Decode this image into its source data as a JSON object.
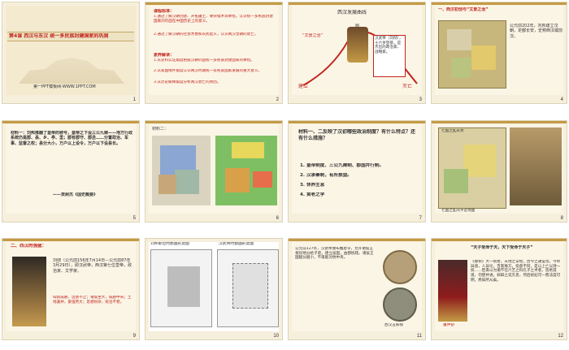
{
  "slides": [
    {
      "n": "1",
      "title": "第4课  西汉与东汉  统一多民族封建国家的巩固",
      "site": "第一PPT模板网-WWW.1PPT.COM"
    },
    {
      "n": "2",
      "heading": "课程标准：",
      "lines": [
        "1.通过了解汉朝创建、开拓疆土、尊崇儒术等举措，认识统一多民族封建国家的巩固在中国历史上的意义。",
        "2.通过了解汉朝的社会矛盾和农民起义，认识两汉皇朝的衰亡。"
      ],
      "heading2": "素养解读：",
      "lines2": [
        "1.从史料实证角度把握汉朝巩固统一多民族封建国家的举措。",
        "2.从家国情怀角度认识两汉时期统一多民族国家发展的重大意义。",
        "3.从历史解释角度分析两汉衰亡的原因。"
      ]
    },
    {
      "n": "3",
      "title": "西汉发展曲线",
      "label_tu": "图",
      "left_label": "“文景之治”",
      "apex_label": "汉武帝（刘彻），十六岁登基，是杰出的政治家、战略家。",
      "start": "建立",
      "end": "灭亡"
    },
    {
      "n": "4",
      "heading": "一、西汉初创与“文景之治”",
      "text": "公元前202年，刘邦建立汉朝，定都长安，史称西汉或前汉。"
    },
    {
      "n": "5",
      "quote": "材料一：刘邦推翻了皇帝的称号，皇帝之下设三公九卿——地方行政系统仍是郡、县、乡、亭、里；郡有郡守、郡丞……分置政治、军事、监督之权；县分大小，万户以上设令，万户以下设县长。",
      "source": "——贾树杰《国史概要》"
    },
    {
      "n": "6",
      "label": "材料二："
    },
    {
      "n": "7",
      "question": "材料一、二反映了汉初哪些政治制度？有什么特点？还有什么措施？",
      "points": [
        "1. 皇帝制度、三公九卿制、郡国并行制。",
        "2. 汉承秦制，有所损益。",
        "3. 休养生息",
        "4. 黄老之学"
      ]
    },
    {
      "n": "8",
      "map_title": "七国之乱形势",
      "caption": "七国之乱的平定地图"
    },
    {
      "n": "9",
      "heading": "二、西汉的强盛：",
      "bio": "刘彻（公元前156年7月14日－公元前87年3月29日），即汉武帝，西汉第七位皇帝，政治家、文学家。",
      "extra": "匈奴威胁，边患不止；诸侯坐大，威胁中央；土地兼并，豪强势大；思想纷杂，统治不稳。"
    },
    {
      "n": "10",
      "map1": "刘邦即位时郡国形势图",
      "map2": "汉武帝时郡国形势图"
    },
    {
      "n": "11",
      "article": "公元前127年，汉武帝颁布推恩令，允许诸侯王将封地分给子弟，建立侯国，由郡统辖。诸侯王国越分越小，不再能对抗中央。",
      "caption": "西汉五铢钱"
    },
    {
      "n": "12",
      "quote": "“天子受命于天，天下受命于天子”",
      "body": "《春秋》大一统者，天地之常经，古今之通谊也。今师异道，人异论，百家殊方，指意不同，是以上亡以持一统……臣愚以为诸不在六艺之科孔子之术者，皆绝其道，勿使并进。邪辟之说灭息，然后统纪可一而法度可明，民知所从矣。",
      "name": "董仲舒"
    }
  ],
  "colors": {
    "accent": "#c0251d",
    "paper": "#fbf5e6"
  }
}
